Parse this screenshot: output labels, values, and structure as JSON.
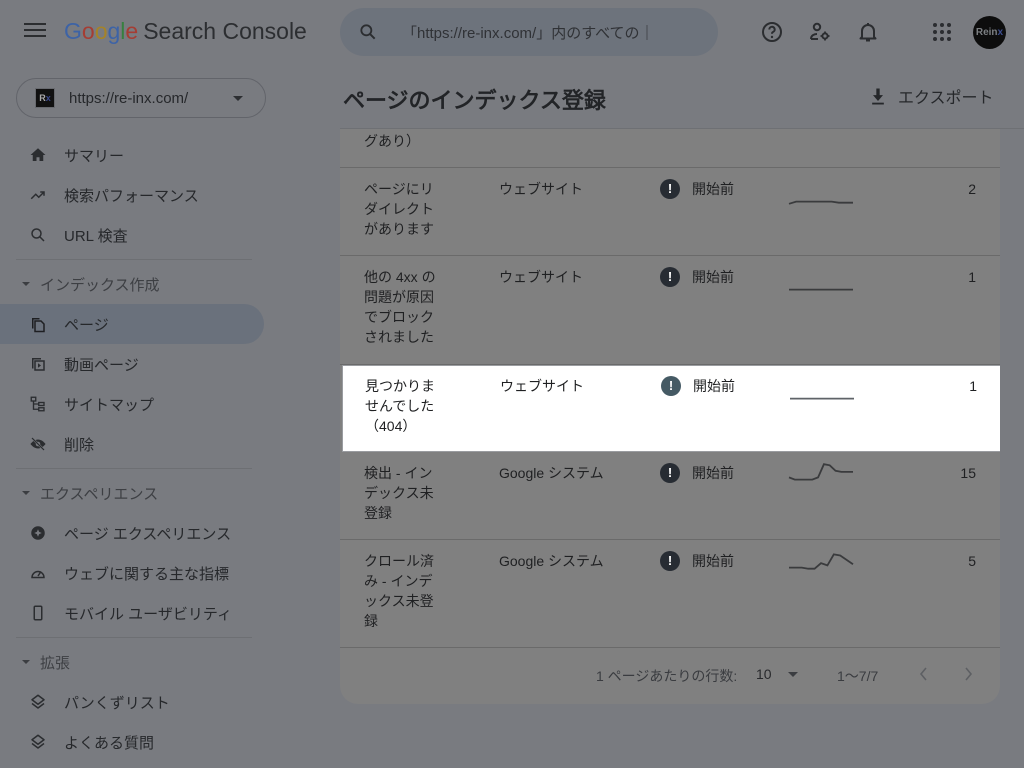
{
  "app": {
    "logo_parts": [
      "G",
      "o",
      "o",
      "g",
      "l",
      "e"
    ],
    "product": "Search Console"
  },
  "search": {
    "placeholder": "「https://re-inx.com/」内のすべての URL を検査",
    "visible_text": "「https://re-inx.com/」内のすべての｜"
  },
  "header_icons": [
    "help-icon",
    "manage-users-icon",
    "notifications-icon",
    "apps-icon"
  ],
  "avatar": {
    "text": "Rein",
    "text_accent": "x"
  },
  "property": {
    "favicon_text": "R",
    "favicon_accent": "x",
    "url": "https://re-inx.com/"
  },
  "sidebar": {
    "items_top": [
      {
        "label": "サマリー",
        "icon": "home-icon"
      },
      {
        "label": "検索パフォーマンス",
        "icon": "trending-up-icon"
      },
      {
        "label": "URL 検査",
        "icon": "search-icon"
      }
    ],
    "sections": [
      {
        "title": "インデックス作成",
        "items": [
          {
            "label": "ページ",
            "icon": "pages-icon",
            "active": true
          },
          {
            "label": "動画ページ",
            "icon": "video-pages-icon"
          },
          {
            "label": "サイトマップ",
            "icon": "sitemap-icon"
          },
          {
            "label": "削除",
            "icon": "removals-icon"
          }
        ]
      },
      {
        "title": "エクスペリエンス",
        "items": [
          {
            "label": "ページ エクスペリエンス",
            "icon": "page-experience-icon"
          },
          {
            "label": "ウェブに関する主な指標",
            "icon": "speed-gauge-icon"
          },
          {
            "label": "モバイル ユーザビリティ",
            "icon": "mobile-icon"
          }
        ]
      },
      {
        "title": "拡張",
        "items": [
          {
            "label": "パンくずリスト",
            "icon": "layers-icon"
          },
          {
            "label": "よくある質問",
            "icon": "layers-icon"
          }
        ]
      }
    ]
  },
  "main": {
    "title": "ページのインデックス登録",
    "export_label": "エクスポート",
    "partial_row_text": "グあり）",
    "rows": [
      {
        "reason": "ページにリダイレクトがあります",
        "source": "ウェブサイト",
        "status": "開始前",
        "count": "2",
        "trend": [
          0.1,
          0.2,
          0.2,
          0.2,
          0.2,
          0.2,
          0.2,
          0.15,
          0.15,
          0.15
        ],
        "highlighted": false
      },
      {
        "reason": "他の 4xx の問題が原因でブロックされました",
        "source": "ウェブサイト",
        "status": "開始前",
        "count": "1",
        "trend": [
          0.2,
          0.2,
          0.2,
          0.2,
          0.2,
          0.2,
          0.2,
          0.2,
          0.2,
          0.2
        ],
        "highlighted": false
      },
      {
        "reason": "見つかりませんでした（404）",
        "source": "ウェブサイト",
        "status": "開始前",
        "count": "1",
        "trend": [
          0.2,
          0.2,
          0.2,
          0.2,
          0.2,
          0.2,
          0.2,
          0.2,
          0.2,
          0.2
        ],
        "highlighted": true
      },
      {
        "reason": "検出 - インデックス未登録",
        "source": "Google システム",
        "status": "開始前",
        "count": "15",
        "trend": [
          0.3,
          0.2,
          0.2,
          0.2,
          0.2,
          0.3,
          0.9,
          0.85,
          0.6,
          0.55,
          0.55,
          0.55
        ],
        "highlighted": false
      },
      {
        "reason": "クロール済み - インデックス未登録",
        "source": "Google システム",
        "status": "開始前",
        "count": "5",
        "trend": [
          0.2,
          0.2,
          0.2,
          0.15,
          0.15,
          0.4,
          0.3,
          0.8,
          0.75,
          0.55,
          0.35
        ],
        "highlighted": false
      }
    ],
    "footer": {
      "rows_per_page_label": "1 ページあたりの行数:",
      "rows_per_page_value": "10",
      "range": "1～7/7"
    }
  }
}
